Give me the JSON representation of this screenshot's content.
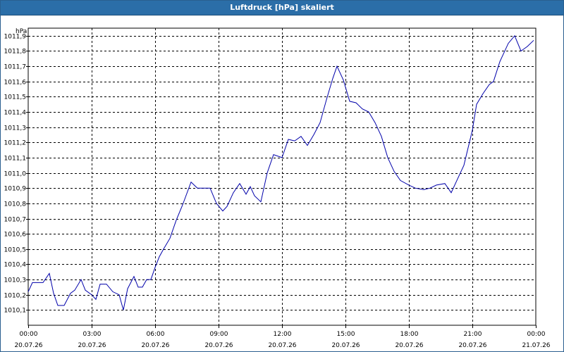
{
  "window": {
    "title": "Luftdruck [hPa] skaliert"
  },
  "colors": {
    "titlebar": "#2b6ea8",
    "line": "#0000aa",
    "grid": "#000000",
    "frame": "#2a5f8f"
  },
  "chart_data": {
    "type": "line",
    "title": "Luftdruck [hPa] skaliert",
    "ylabel": "hPa",
    "xlabel": "",
    "grid": true,
    "legend": "none",
    "ylim": [
      1010.0,
      1011.95
    ],
    "xlim_hours": [
      0,
      24
    ],
    "y_ticks": [
      "1010,1",
      "1010,2",
      "1010,3",
      "1010,4",
      "1010,5",
      "1010,6",
      "1010,7",
      "1010,8",
      "1010,9",
      "1011,0",
      "1011,1",
      "1011,2",
      "1011,3",
      "1011,4",
      "1011,5",
      "1011,6",
      "1011,7",
      "1011,8",
      "1011,9"
    ],
    "y_tick_values": [
      1010.1,
      1010.2,
      1010.3,
      1010.4,
      1010.5,
      1010.6,
      1010.7,
      1010.8,
      1010.9,
      1011.0,
      1011.1,
      1011.2,
      1011.3,
      1011.4,
      1011.5,
      1011.6,
      1011.7,
      1011.8,
      1011.9
    ],
    "x_ticks": [
      {
        "hour": 0,
        "time": "00:00",
        "date": "20.07.26"
      },
      {
        "hour": 3,
        "time": "03:00",
        "date": "20.07.26"
      },
      {
        "hour": 6,
        "time": "06:00",
        "date": "20.07.26"
      },
      {
        "hour": 9,
        "time": "09:00",
        "date": "20.07.26"
      },
      {
        "hour": 12,
        "time": "12:00",
        "date": "20.07.26"
      },
      {
        "hour": 15,
        "time": "15:00",
        "date": "20.07.26"
      },
      {
        "hour": 18,
        "time": "18:00",
        "date": "20.07.26"
      },
      {
        "hour": 21,
        "time": "21:00",
        "date": "20.07.26"
      },
      {
        "hour": 24,
        "time": "00:00",
        "date": "21.07.26"
      }
    ],
    "series": [
      {
        "x": [
          0.0,
          0.2,
          0.4,
          0.7,
          1.0,
          1.2,
          1.4,
          1.7,
          2.0,
          2.2,
          2.5,
          2.7,
          3.0,
          3.2,
          3.4,
          3.7,
          4.0,
          4.3,
          4.5,
          4.7,
          5.0,
          5.2,
          5.4,
          5.6,
          5.8,
          6.0,
          6.2,
          6.4,
          6.7,
          7.0,
          7.3,
          7.7,
          8.0,
          8.3,
          8.6,
          8.9,
          9.2,
          9.4,
          9.7,
          10.0,
          10.3,
          10.5,
          10.7,
          11.0,
          11.3,
          11.6,
          12.0,
          12.3,
          12.6,
          12.9,
          13.2,
          13.5,
          13.8,
          14.1,
          14.4,
          14.6,
          14.9,
          15.2,
          15.5,
          15.8,
          16.1,
          16.4,
          16.7,
          17.0,
          17.3,
          17.6,
          18.0,
          18.3,
          18.7,
          19.0,
          19.3,
          19.7,
          20.0,
          20.3,
          20.6,
          21.0,
          21.2,
          21.5,
          21.8,
          22.0,
          22.3,
          22.7,
          23.0,
          23.3,
          23.6,
          23.9
        ],
        "y": [
          1010.22,
          1010.28,
          1010.28,
          1010.28,
          1010.34,
          1010.21,
          1010.13,
          1010.13,
          1010.21,
          1010.23,
          1010.3,
          1010.23,
          1010.2,
          1010.17,
          1010.27,
          1010.27,
          1010.22,
          1010.2,
          1010.1,
          1010.24,
          1010.32,
          1010.25,
          1010.25,
          1010.3,
          1010.3,
          1010.38,
          1010.45,
          1010.5,
          1010.57,
          1010.69,
          1010.79,
          1010.94,
          1010.9,
          1010.9,
          1010.9,
          1010.8,
          1010.75,
          1010.78,
          1010.87,
          1010.93,
          1010.86,
          1010.91,
          1010.85,
          1010.81,
          1011.0,
          1011.12,
          1011.1,
          1011.22,
          1011.21,
          1011.24,
          1011.18,
          1011.25,
          1011.33,
          1011.48,
          1011.62,
          1011.7,
          1011.61,
          1011.47,
          1011.46,
          1011.42,
          1011.4,
          1011.33,
          1011.24,
          1011.1,
          1011.01,
          1010.95,
          1010.92,
          1010.9,
          1010.89,
          1010.9,
          1010.92,
          1010.93,
          1010.87,
          1010.96,
          1011.05,
          1011.28,
          1011.45,
          1011.52,
          1011.58,
          1011.6,
          1011.73,
          1011.85,
          1011.9,
          1011.8,
          1011.83,
          1011.87
        ]
      }
    ]
  }
}
